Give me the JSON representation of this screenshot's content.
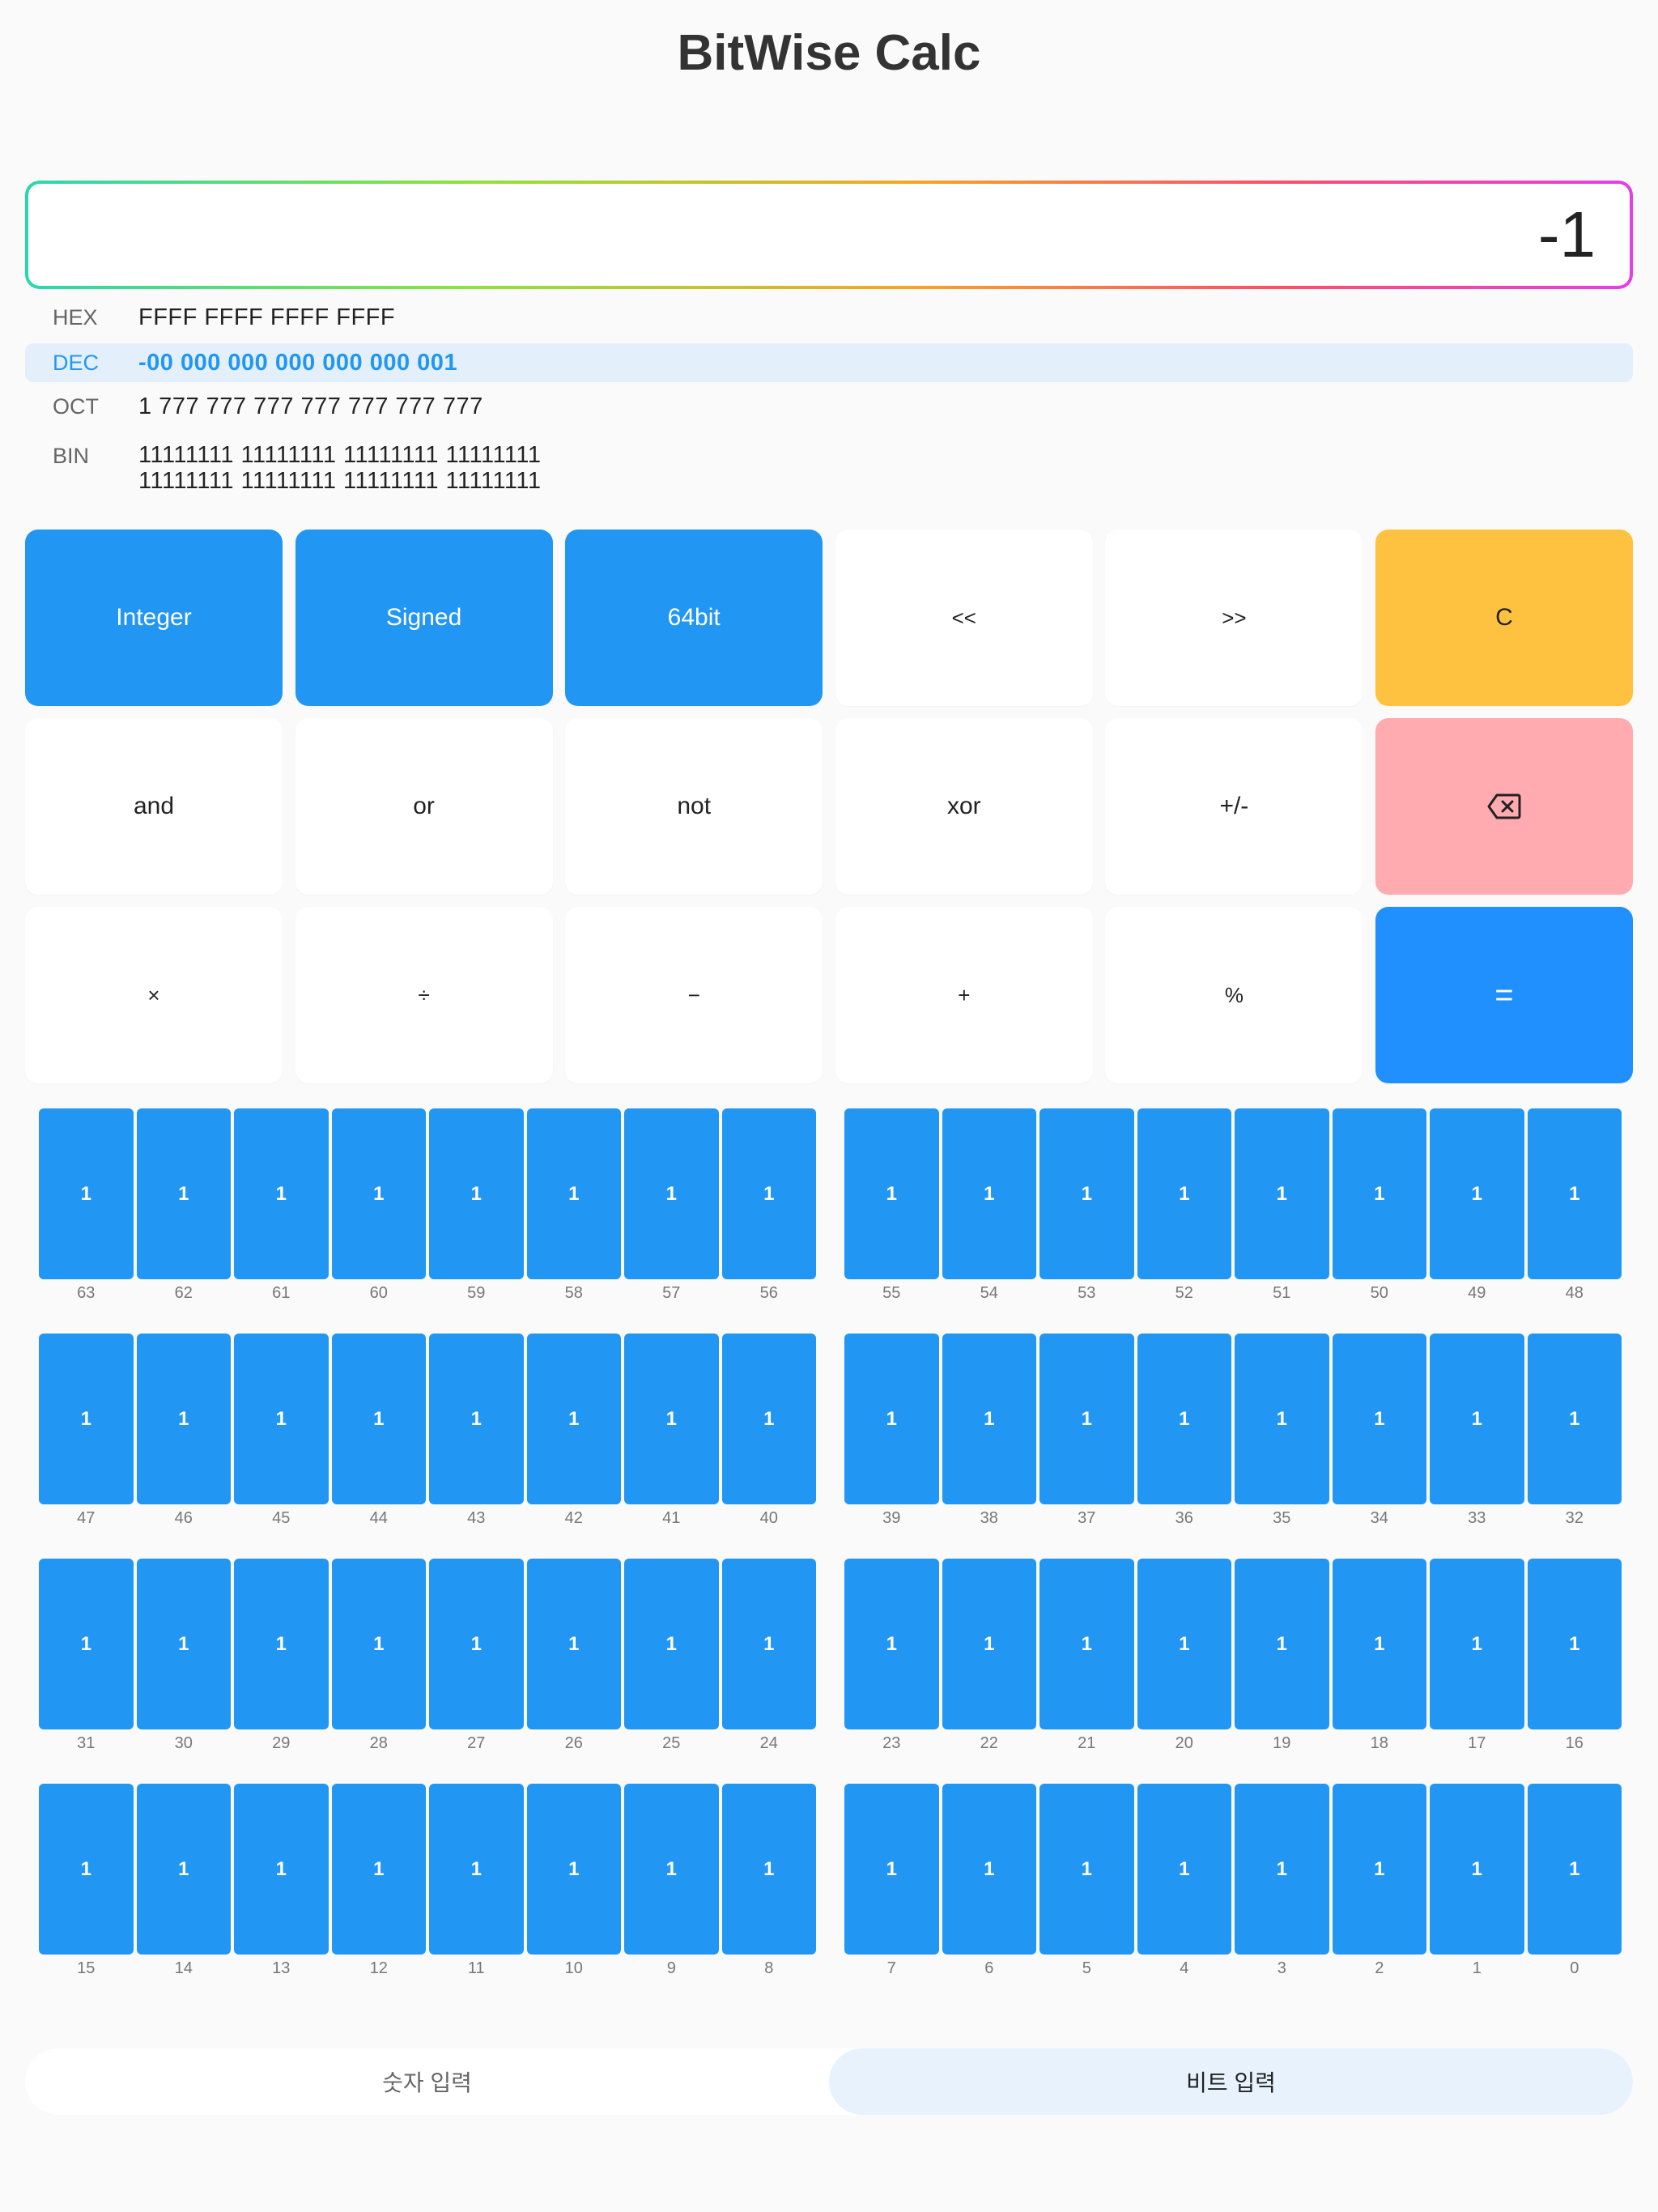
{
  "app": {
    "title": "BitWise Calc"
  },
  "display": {
    "value": "-1"
  },
  "radix": [
    {
      "label": "HEX",
      "value": "FFFF FFFF FFFF FFFF",
      "active": false
    },
    {
      "label": "DEC",
      "value": "-00 000 000 000 000 000 001",
      "active": true
    },
    {
      "label": "OCT",
      "value": "1 777 777 777 777 777 777 777",
      "active": false
    }
  ],
  "bin": {
    "label": "BIN",
    "line1": "11111111 11111111 11111111 11111111",
    "line2": "11111111 11111111 11111111 11111111"
  },
  "keys": {
    "integer": "Integer",
    "signed": "Signed",
    "bits64": "64bit",
    "shl": "<<",
    "shr": ">>",
    "clear": "C",
    "and": "and",
    "or": "or",
    "not": "not",
    "xor": "xor",
    "negate": "+/-",
    "backspace_icon": "backspace-icon",
    "multiply": "×",
    "divide": "÷",
    "subtract": "−",
    "add": "+",
    "modulo": "%",
    "equals": "="
  },
  "bits": [
    1,
    1,
    1,
    1,
    1,
    1,
    1,
    1,
    1,
    1,
    1,
    1,
    1,
    1,
    1,
    1,
    1,
    1,
    1,
    1,
    1,
    1,
    1,
    1,
    1,
    1,
    1,
    1,
    1,
    1,
    1,
    1,
    1,
    1,
    1,
    1,
    1,
    1,
    1,
    1,
    1,
    1,
    1,
    1,
    1,
    1,
    1,
    1,
    1,
    1,
    1,
    1,
    1,
    1,
    1,
    1,
    1,
    1,
    1,
    1,
    1,
    1,
    1,
    1
  ],
  "mode": {
    "number_input": "숫자 입력",
    "bit_input": "비트 입력",
    "selected": "bit_input"
  },
  "colors": {
    "accent": "#2196f3",
    "clear": "#ffc240",
    "backspace": "#ffabaf",
    "equals": "#2190ff"
  }
}
